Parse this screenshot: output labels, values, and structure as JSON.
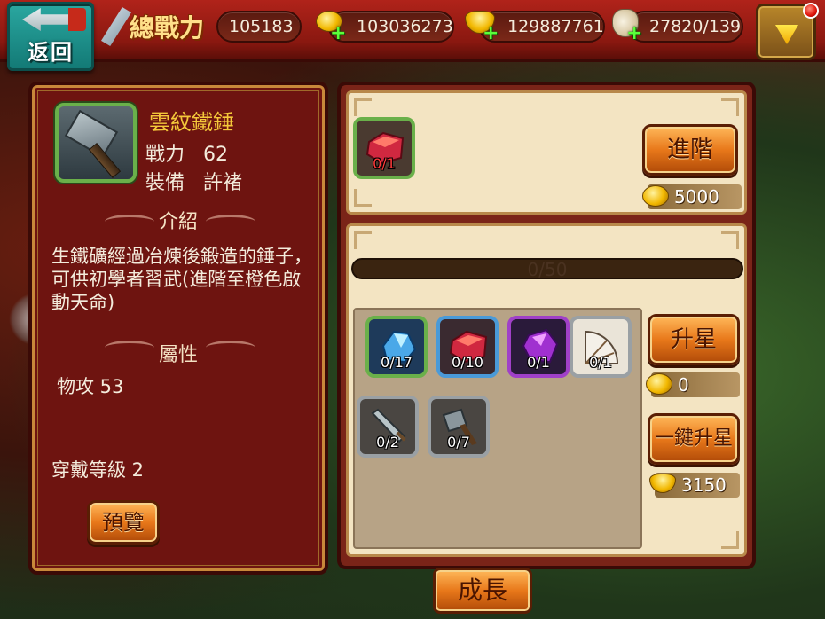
{
  "topbar": {
    "back_label": "返回",
    "power_label": "總戰力",
    "power_value": "105183",
    "coins": "103036273",
    "ingots": "129887761",
    "stamina": "27820/139"
  },
  "item": {
    "name": "雲紋鐵錘",
    "power_label": "戰力",
    "power_value": "62",
    "equip_label": "裝備",
    "equip_value": "許褚",
    "intro_title": "介紹",
    "description": "生鐵礦經過冶煉後鍛造的錘子，可供初學者習武(進階至橙色啟動天命)",
    "attr_title": "屬性",
    "attr_line": "物攻  53",
    "level_line": "穿戴等級  2",
    "preview_label": "預覽"
  },
  "advance": {
    "material_count": "0/1",
    "button_label": "進階",
    "cost": "5000"
  },
  "star": {
    "progress_text": "0/50",
    "progress_value": 0,
    "materials": [
      {
        "count": "0/17",
        "kind": "blue-crystal"
      },
      {
        "count": "0/10",
        "kind": "red-ore"
      },
      {
        "count": "0/1",
        "kind": "purple-crystal"
      },
      {
        "count": "0/1",
        "kind": "fan"
      },
      {
        "count": "0/2",
        "kind": "sword"
      },
      {
        "count": "0/7",
        "kind": "hammer"
      }
    ],
    "upgrade_label": "升星",
    "upgrade_cost": "0",
    "one_key_label": "一鍵升星",
    "one_key_cost": "3150"
  },
  "tab": {
    "growth_label": "成長"
  },
  "colors": {
    "panel_red": "#6e1410",
    "cream": "#f3e4c2",
    "gold_text": "#f4c83a",
    "button_orange": "#e8781a"
  }
}
